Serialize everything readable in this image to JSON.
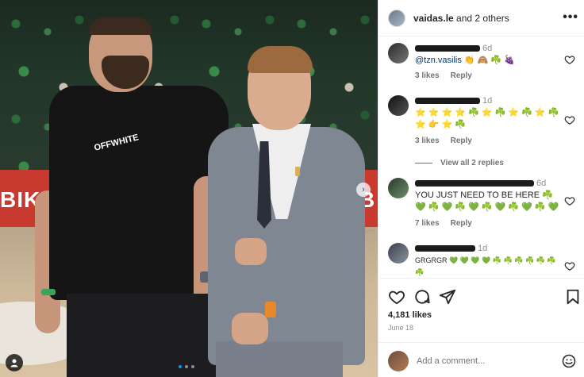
{
  "post": {
    "author": "vaidas.le",
    "author_suffix": "and 2 others",
    "photo_banner_left": "BIKAU",
    "photo_banner_right": "B",
    "shirt_logo": "OFFWHITE"
  },
  "comments": [
    {
      "time": "6d",
      "mention": "@tzn.vasilis",
      "text": "👏 🙈 ☘️ 🍇",
      "likes": "3 likes",
      "reply": "Reply"
    },
    {
      "time": "1d",
      "text": "⭐ ⭐ ⭐ ⭐ ☘️ ⭐ ☘️ ⭐ ☘️ ⭐ ☘️ ⭐ 👉 ⭐ ☘️",
      "likes": "3 likes",
      "reply": "Reply"
    },
    {
      "time": "6d",
      "text": "YOU JUST NEED TO BE HERE ☘️ 💚 ☘️ 💚 ☘️ 💚 ☘️ 💚 ☘️ 💚 ☘️ 💚",
      "likes": "7 likes",
      "reply": "Reply"
    },
    {
      "time": "1d",
      "text": "GRGRGR 💚 💚 💚 💚 ☘️ ☘️ ☘️ ☘️ ☘️ ☘️ ☘️",
      "likes": "",
      "reply": ""
    }
  ],
  "view_replies": "View all 2 replies",
  "likes_count": "4,181 likes",
  "post_date": "June 18",
  "comment_placeholder": "Add a comment...",
  "colors": {
    "accent_blue": "#0095f6",
    "mention": "#00376b",
    "muted": "#8e8e8e"
  },
  "icons": [
    "more-icon",
    "heart-icon",
    "comment-icon",
    "share-icon",
    "bookmark-icon",
    "emoji-icon",
    "chevron-right-icon",
    "user-tag-icon"
  ]
}
